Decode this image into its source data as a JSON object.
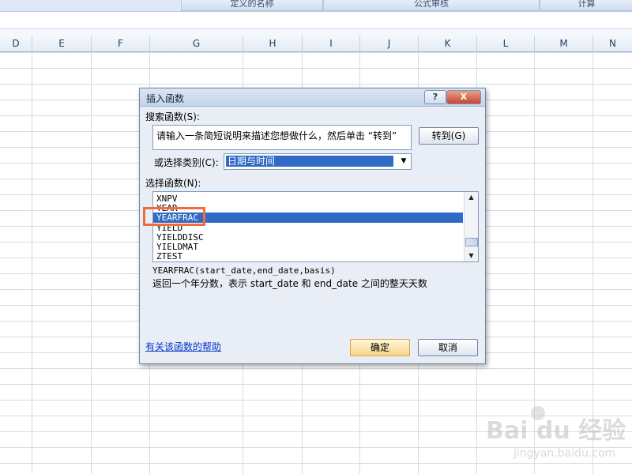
{
  "ribbon": {
    "groups": [
      "定义的名称",
      "公式审核",
      "计算"
    ]
  },
  "columns": [
    "D",
    "E",
    "F",
    "G",
    "H",
    "I",
    "J",
    "K",
    "L",
    "M",
    "N"
  ],
  "dialog": {
    "title": "插入函数",
    "help_button": "?",
    "close_button": "X",
    "search_label": "搜索函数(S):",
    "search_value": "请输入一条简短说明来描述您想做什么，然后单击 “转到”",
    "go_button": "转到(G)",
    "category_label": "或选择类别(C):",
    "category_value": "日期与时间",
    "function_list_label": "选择函数(N):",
    "functions": [
      "XNPV",
      "YEAR",
      "YEARFRAC",
      "YIELD",
      "YIELDDISC",
      "YIELDMAT",
      "ZTEST"
    ],
    "selected_function": "YEARFRAC",
    "signature": "YEARFRAC(start_date,end_date,basis)",
    "description": "返回一个年分数，表示 start_date 和 end_date 之间的整天天数",
    "help_link": "有关该函数的帮助",
    "ok_button": "确定",
    "cancel_button": "取消"
  },
  "watermark": {
    "brand": "Bai du 经验",
    "url": "jingyan.baidu.com"
  },
  "colors": {
    "selection": "#316ac5",
    "highlight_box": "#f26b3a",
    "link": "#0033cc"
  }
}
